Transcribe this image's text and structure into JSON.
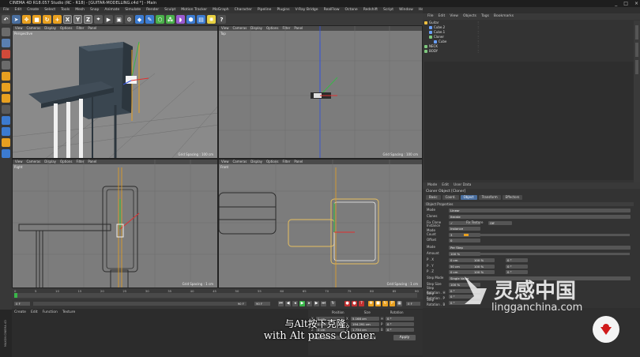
{
  "window": {
    "title": "CINEMA 4D R18.057 Studio (RC - R18) - [GUITAR-MODELLING.c4d *] - Main",
    "controls": [
      "_",
      "□",
      "×"
    ],
    "layout_label": "Layout",
    "layout_value": "Startup (User)"
  },
  "menubar": [
    "File",
    "Edit",
    "Create",
    "Select",
    "Tools",
    "Mesh",
    "Snap",
    "Animate",
    "Simulate",
    "Render",
    "Sculpt",
    "Motion Tracker",
    "MoGraph",
    "Character",
    "Pipeline",
    "Plugins",
    "V-Ray Bridge",
    "RealFlow",
    "Octane",
    "Redshift",
    "Script",
    "Window",
    "Help"
  ],
  "toolbar": {
    "icons": [
      "undo-icon",
      "pointer-icon",
      "move-icon",
      "scale-icon",
      "rotate-icon",
      "add-icon"
    ],
    "axes": [
      "X",
      "Y",
      "Z"
    ],
    "buttons": [
      "render-view-icon",
      "render-icon",
      "render-settings-icon",
      "cube-icon",
      "pen-icon",
      "subdivision-icon",
      "array-icon",
      "deformer-icon",
      "scene-icon",
      "camera-icon",
      "light-icon"
    ]
  },
  "viewports": [
    {
      "name": "Perspective",
      "menu": [
        "View",
        "Cameras",
        "Display",
        "Options",
        "Filter",
        "Panel"
      ],
      "grid": "Grid Spacing : 100 cm"
    },
    {
      "name": "Top",
      "menu": [
        "View",
        "Cameras",
        "Display",
        "Options",
        "Filter",
        "Panel"
      ],
      "grid": "Grid Spacing : 100 cm"
    },
    {
      "name": "Right",
      "menu": [
        "View",
        "Cameras",
        "Display",
        "Options",
        "Filter",
        "Panel"
      ],
      "grid": "Grid Spacing : 1 cm"
    },
    {
      "name": "Front",
      "menu": [
        "View",
        "Cameras",
        "Display",
        "Options",
        "Filter",
        "Panel"
      ],
      "grid": "Grid Spacing : 1 cm"
    }
  ],
  "object_manager": {
    "menu": [
      "File",
      "Edit",
      "View",
      "Objects",
      "Tags",
      "Bookmarks"
    ],
    "objects": [
      {
        "name": "Guitar",
        "indent": 0,
        "color": "#f0c040"
      },
      {
        "name": "Cube.2",
        "indent": 1,
        "color": "#6aa0ff"
      },
      {
        "name": "Cube.1",
        "indent": 1,
        "color": "#6aa0ff"
      },
      {
        "name": "Cloner",
        "indent": 1,
        "color": "#7ec87e"
      },
      {
        "name": "Cube",
        "indent": 2,
        "color": "#6aa0ff"
      },
      {
        "name": "NECK",
        "indent": 0,
        "color": "#7ec87e"
      },
      {
        "name": "BODY",
        "indent": 0,
        "color": "#7ec87e"
      }
    ]
  },
  "attribute_manager": {
    "menu": [
      "Mode",
      "Edit",
      "User Data"
    ],
    "title": "Cloner Object [Cloner]",
    "tabs": [
      {
        "label": "Basic",
        "active": false
      },
      {
        "label": "Coord.",
        "active": false
      },
      {
        "label": "Object",
        "active": true
      },
      {
        "label": "Transform",
        "active": false
      },
      {
        "label": "Effectors",
        "active": false
      }
    ],
    "section": "Object Properties",
    "props": [
      {
        "label": "Mode",
        "value": "Linear"
      },
      {
        "label": "Clones",
        "value": "Iterate"
      },
      {
        "label": "Fix Clone",
        "value": "✓"
      },
      {
        "label": "Fix Texture",
        "value": "Off"
      },
      {
        "label": "Instance Mode",
        "value": "Instance"
      },
      {
        "label": "Count",
        "value": "3"
      },
      {
        "label": "Offset",
        "value": "0"
      },
      {
        "label": "Mode",
        "value": "Per Step"
      },
      {
        "label": "Amount",
        "value": "100 %"
      },
      {
        "label": "P . X",
        "value": "0 cm"
      },
      {
        "label": "P . Y",
        "value": "50 cm"
      },
      {
        "label": "P . Z",
        "value": "0 cm"
      },
      {
        "label": "Step Mode",
        "value": "Single Value"
      },
      {
        "label": "Step Size",
        "value": "100 %"
      },
      {
        "label": "Step Rotation . H",
        "value": "0 °"
      },
      {
        "label": "Step Rotation . P",
        "value": "0 °"
      },
      {
        "label": "Step Rotation . B",
        "value": "0 °"
      }
    ],
    "scale_values": [
      "100 %",
      "100 %",
      "100 %"
    ],
    "rot_values": [
      "0 °",
      "0 °",
      "0 °"
    ]
  },
  "timeline": {
    "ticks": [
      "0",
      "5",
      "10",
      "15",
      "20",
      "25",
      "30",
      "35",
      "40",
      "45",
      "50",
      "55",
      "60",
      "65",
      "70",
      "75",
      "80",
      "85",
      "90"
    ],
    "frame_start": "0 F",
    "frame_end": "90 F",
    "current": "0 F",
    "end_display": "90 F",
    "right_value": "0 F"
  },
  "bottom": {
    "menu": [
      "Create",
      "Edit",
      "Function",
      "Texture"
    ]
  },
  "coordinates": {
    "headers": [
      "Position",
      "Size",
      "Rotation"
    ],
    "rows": [
      [
        "X",
        "0 cm",
        "X",
        "5.168 cm",
        "H",
        "0 °"
      ],
      [
        "Y",
        "0 cm",
        "Y",
        "194.291 cm",
        "P",
        "0 °"
      ],
      [
        "Z",
        "0 cm",
        "Z",
        "1.734 cm",
        "B",
        "0 °"
      ]
    ],
    "mode_left": "Object (Rel)",
    "mode_right": "Size",
    "apply": "Apply"
  },
  "subtitles": {
    "line1": "与Alt按下克隆。",
    "line2": "with Alt press Cloner."
  },
  "watermark": {
    "brand": "灵感中国",
    "url": "lingganchina.com"
  },
  "colors": {
    "accent": "#4a6fa0",
    "viewport_bg": "#7c7c7c",
    "panel_bg": "#333333",
    "orange": "#e8a020",
    "green": "#3ab54a",
    "red": "#e03030",
    "blue": "#3050e0"
  }
}
